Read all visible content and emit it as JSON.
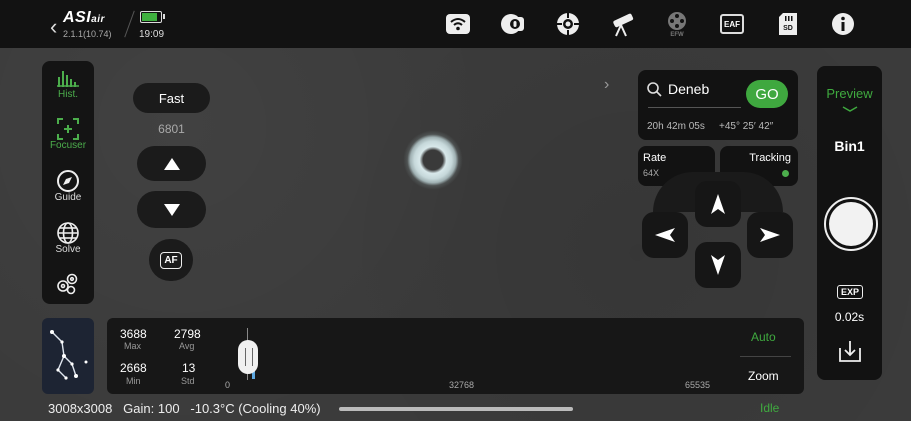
{
  "header": {
    "brand": "ASIair",
    "version": "2.1.1(10.74)",
    "time": "19:09",
    "battery_level": 0.85,
    "icons": [
      "wifi-icon",
      "camera-icon",
      "mount-crosshair-icon",
      "telescope-icon",
      "filter-wheel-icon",
      "eaf-icon",
      "sd-card-icon",
      "info-icon"
    ],
    "eaf_label": "EAF",
    "sd_label": "SD",
    "efw_label": "EFW"
  },
  "left_nav": {
    "items": [
      {
        "label": "Hist.",
        "icon": "histogram-icon",
        "active": true
      },
      {
        "label": "Focuser",
        "icon": "focus-icon",
        "active": true
      },
      {
        "label": "Guide",
        "icon": "compass-icon",
        "active": false
      },
      {
        "label": "Solve",
        "icon": "globe-icon",
        "active": false
      }
    ]
  },
  "focuser": {
    "speed": "Fast",
    "position": "6801",
    "af_label": "AF"
  },
  "goto": {
    "target": "Deneb",
    "go_label": "GO",
    "ra": "20h 42m 05s",
    "dec": "+45° 25′ 42″",
    "expand_arrow": "›"
  },
  "mount": {
    "rate_label": "Rate",
    "rate_value": "64X",
    "tracking_label": "Tracking",
    "tracking_on": true
  },
  "right_bar": {
    "mode": "Preview",
    "bin": "Bin1",
    "exp_label": "EXP",
    "exposure": "0.02s"
  },
  "histogram": {
    "max": "3688",
    "max_label": "Max",
    "avg": "2798",
    "avg_label": "Avg",
    "min": "2668",
    "min_label": "Min",
    "std": "13",
    "std_label": "Std",
    "axis_min": "0",
    "axis_mid": "32768",
    "axis_max": "65535",
    "auto_label": "Auto",
    "zoom_label": "Zoom"
  },
  "status": {
    "text": "3008x3008   Gain: 100   -10.3°C (Cooling 40%)",
    "state": "Idle"
  },
  "colors": {
    "accent_green": "#3fa83f",
    "bar_bg": "#121212"
  }
}
